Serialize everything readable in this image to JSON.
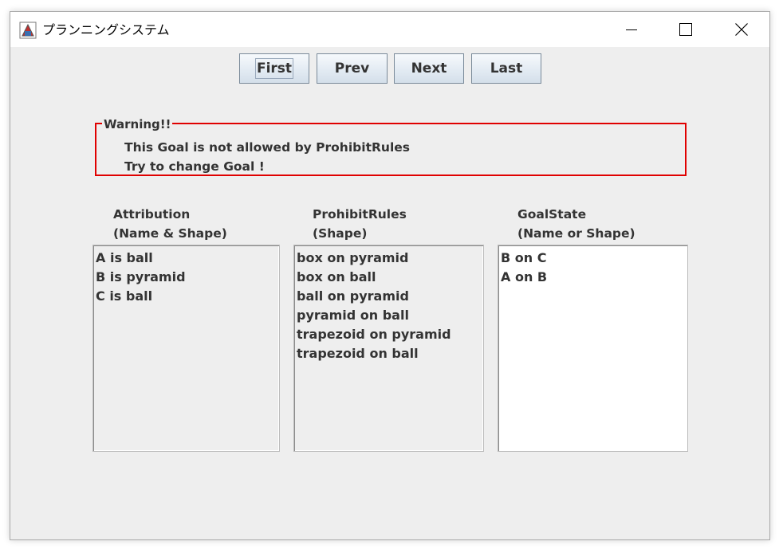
{
  "window": {
    "title": "プランニングシステム",
    "icon": "java-app-icon"
  },
  "nav": {
    "first": "First",
    "prev": "Prev",
    "next": "Next",
    "last": "Last"
  },
  "warning": {
    "title": "Warning!!",
    "line1": "This Goal is not allowed by ProhibitRules",
    "line2": "Try to change Goal !",
    "border_color": "#e00000"
  },
  "columns": {
    "attribution": {
      "heading1": "Attribution",
      "heading2": "(Name & Shape)",
      "items": [
        "A is ball",
        "B is pyramid",
        "C is ball"
      ]
    },
    "prohibit": {
      "heading1": "ProhibitRules",
      "heading2": "(Shape)",
      "items": [
        "box on pyramid",
        "box on ball",
        "ball on pyramid",
        "pyramid on ball",
        "trapezoid on pyramid",
        "trapezoid on ball"
      ]
    },
    "goal": {
      "heading1": "GoalState",
      "heading2": "(Name or Shape)",
      "items": [
        "B on C",
        "A on B"
      ]
    }
  }
}
